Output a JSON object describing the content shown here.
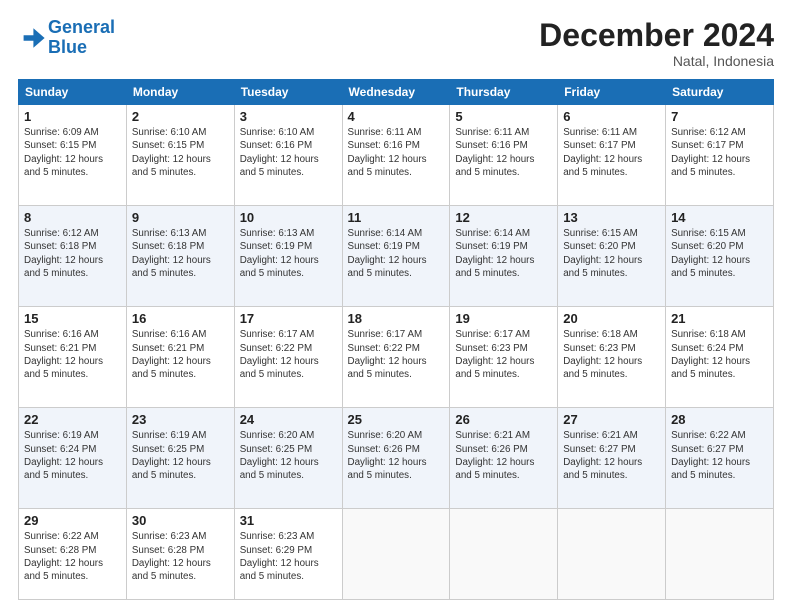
{
  "logo": {
    "line1": "General",
    "line2": "Blue"
  },
  "title": "December 2024",
  "subtitle": "Natal, Indonesia",
  "weekdays": [
    "Sunday",
    "Monday",
    "Tuesday",
    "Wednesday",
    "Thursday",
    "Friday",
    "Saturday"
  ],
  "weeks": [
    [
      {
        "day": 1,
        "sunrise": "6:09 AM",
        "sunset": "6:15 PM",
        "daylight": "12 hours and 5 minutes."
      },
      {
        "day": 2,
        "sunrise": "6:10 AM",
        "sunset": "6:15 PM",
        "daylight": "12 hours and 5 minutes."
      },
      {
        "day": 3,
        "sunrise": "6:10 AM",
        "sunset": "6:16 PM",
        "daylight": "12 hours and 5 minutes."
      },
      {
        "day": 4,
        "sunrise": "6:11 AM",
        "sunset": "6:16 PM",
        "daylight": "12 hours and 5 minutes."
      },
      {
        "day": 5,
        "sunrise": "6:11 AM",
        "sunset": "6:16 PM",
        "daylight": "12 hours and 5 minutes."
      },
      {
        "day": 6,
        "sunrise": "6:11 AM",
        "sunset": "6:17 PM",
        "daylight": "12 hours and 5 minutes."
      },
      {
        "day": 7,
        "sunrise": "6:12 AM",
        "sunset": "6:17 PM",
        "daylight": "12 hours and 5 minutes."
      }
    ],
    [
      {
        "day": 8,
        "sunrise": "6:12 AM",
        "sunset": "6:18 PM",
        "daylight": "12 hours and 5 minutes."
      },
      {
        "day": 9,
        "sunrise": "6:13 AM",
        "sunset": "6:18 PM",
        "daylight": "12 hours and 5 minutes."
      },
      {
        "day": 10,
        "sunrise": "6:13 AM",
        "sunset": "6:19 PM",
        "daylight": "12 hours and 5 minutes."
      },
      {
        "day": 11,
        "sunrise": "6:14 AM",
        "sunset": "6:19 PM",
        "daylight": "12 hours and 5 minutes."
      },
      {
        "day": 12,
        "sunrise": "6:14 AM",
        "sunset": "6:19 PM",
        "daylight": "12 hours and 5 minutes."
      },
      {
        "day": 13,
        "sunrise": "6:15 AM",
        "sunset": "6:20 PM",
        "daylight": "12 hours and 5 minutes."
      },
      {
        "day": 14,
        "sunrise": "6:15 AM",
        "sunset": "6:20 PM",
        "daylight": "12 hours and 5 minutes."
      }
    ],
    [
      {
        "day": 15,
        "sunrise": "6:16 AM",
        "sunset": "6:21 PM",
        "daylight": "12 hours and 5 minutes."
      },
      {
        "day": 16,
        "sunrise": "6:16 AM",
        "sunset": "6:21 PM",
        "daylight": "12 hours and 5 minutes."
      },
      {
        "day": 17,
        "sunrise": "6:17 AM",
        "sunset": "6:22 PM",
        "daylight": "12 hours and 5 minutes."
      },
      {
        "day": 18,
        "sunrise": "6:17 AM",
        "sunset": "6:22 PM",
        "daylight": "12 hours and 5 minutes."
      },
      {
        "day": 19,
        "sunrise": "6:17 AM",
        "sunset": "6:23 PM",
        "daylight": "12 hours and 5 minutes."
      },
      {
        "day": 20,
        "sunrise": "6:18 AM",
        "sunset": "6:23 PM",
        "daylight": "12 hours and 5 minutes."
      },
      {
        "day": 21,
        "sunrise": "6:18 AM",
        "sunset": "6:24 PM",
        "daylight": "12 hours and 5 minutes."
      }
    ],
    [
      {
        "day": 22,
        "sunrise": "6:19 AM",
        "sunset": "6:24 PM",
        "daylight": "12 hours and 5 minutes."
      },
      {
        "day": 23,
        "sunrise": "6:19 AM",
        "sunset": "6:25 PM",
        "daylight": "12 hours and 5 minutes."
      },
      {
        "day": 24,
        "sunrise": "6:20 AM",
        "sunset": "6:25 PM",
        "daylight": "12 hours and 5 minutes."
      },
      {
        "day": 25,
        "sunrise": "6:20 AM",
        "sunset": "6:26 PM",
        "daylight": "12 hours and 5 minutes."
      },
      {
        "day": 26,
        "sunrise": "6:21 AM",
        "sunset": "6:26 PM",
        "daylight": "12 hours and 5 minutes."
      },
      {
        "day": 27,
        "sunrise": "6:21 AM",
        "sunset": "6:27 PM",
        "daylight": "12 hours and 5 minutes."
      },
      {
        "day": 28,
        "sunrise": "6:22 AM",
        "sunset": "6:27 PM",
        "daylight": "12 hours and 5 minutes."
      }
    ],
    [
      {
        "day": 29,
        "sunrise": "6:22 AM",
        "sunset": "6:28 PM",
        "daylight": "12 hours and 5 minutes."
      },
      {
        "day": 30,
        "sunrise": "6:23 AM",
        "sunset": "6:28 PM",
        "daylight": "12 hours and 5 minutes."
      },
      {
        "day": 31,
        "sunrise": "6:23 AM",
        "sunset": "6:29 PM",
        "daylight": "12 hours and 5 minutes."
      },
      null,
      null,
      null,
      null
    ]
  ]
}
